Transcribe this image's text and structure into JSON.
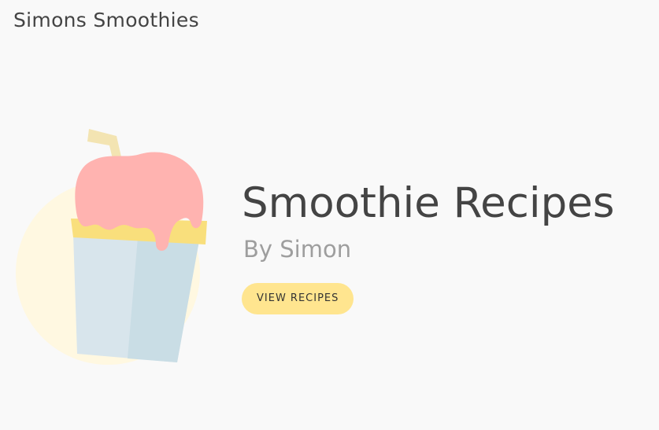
{
  "header": {
    "brand": "Simons Smoothies"
  },
  "hero": {
    "illustration": "smoothie-cup-icon",
    "title": "Smoothie Recipes",
    "subtitle": "By Simon",
    "button_label": "VIEW RECIPES"
  },
  "colors": {
    "background": "#f9f9f9",
    "text_primary": "#444444",
    "text_secondary": "#9e9e9e",
    "button_bg": "#ffe58f",
    "circle": "#fff8e1",
    "straw": "#f3e4b2",
    "topping": "#ffb3b0",
    "rim": "#f9df7c",
    "cup_light": "#d8e5ec",
    "cup_dark": "#c9dde5"
  }
}
